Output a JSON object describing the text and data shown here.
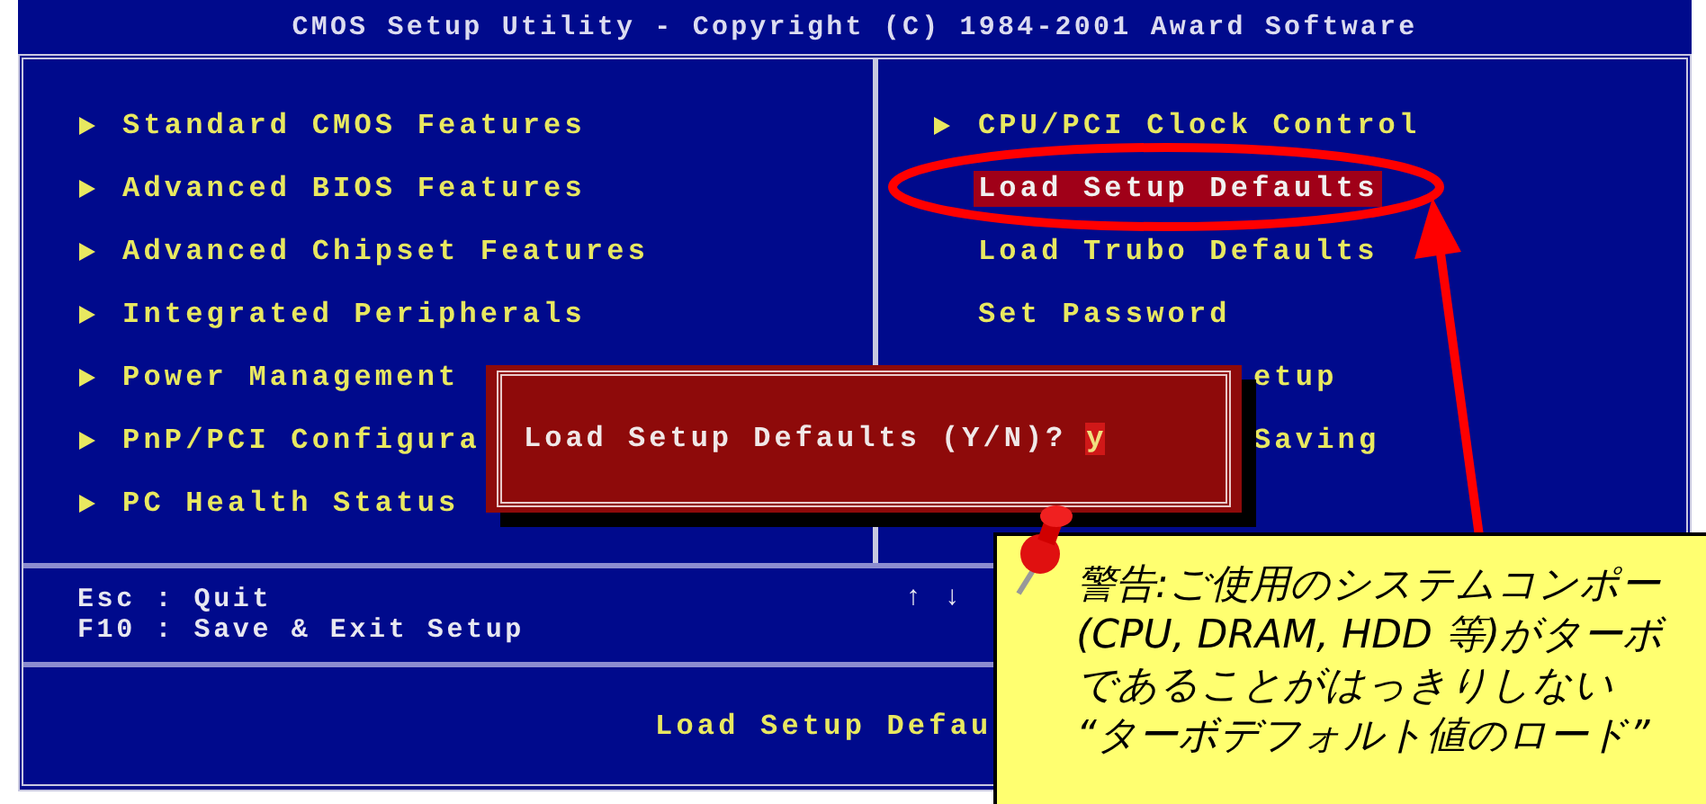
{
  "title": "CMOS Setup Utility - Copyright (C) 1984-2001 Award Software",
  "left_menu": [
    {
      "label": "Standard CMOS Features"
    },
    {
      "label": "Advanced BIOS Features"
    },
    {
      "label": "Advanced Chipset Features"
    },
    {
      "label": "Integrated Peripherals"
    },
    {
      "label": "Power Management"
    },
    {
      "label": "PnP/PCI Configura"
    },
    {
      "label": "PC Health Status"
    }
  ],
  "right_menu": [
    {
      "label": "CPU/PCI Clock Control",
      "kind": "submenu",
      "selected": false
    },
    {
      "label": "Load Setup Defaults",
      "kind": "action",
      "selected": true
    },
    {
      "label": "Load Trubo Defaults",
      "kind": "action",
      "selected": false
    },
    {
      "label": "Set Password",
      "kind": "action",
      "selected": false
    },
    {
      "label": "etup",
      "kind": "partial",
      "selected": false
    },
    {
      "label": "Saving",
      "kind": "partial",
      "selected": false
    }
  ],
  "dialog": {
    "prompt": "Load Setup Defaults (Y/N)?",
    "answer": "y"
  },
  "help": {
    "keys": [
      "Esc : Quit",
      "F10 : Save & Exit Setup"
    ],
    "arrows": "↑ ↓"
  },
  "status": "Load Setup Defau",
  "note": {
    "lines": [
      "警告:ご使用のシステムコンポー",
      "(CPU, DRAM, HDD 等)がターボ",
      "であることがはっきりしない",
      "“ターボデフォルト値のロード”"
    ]
  }
}
